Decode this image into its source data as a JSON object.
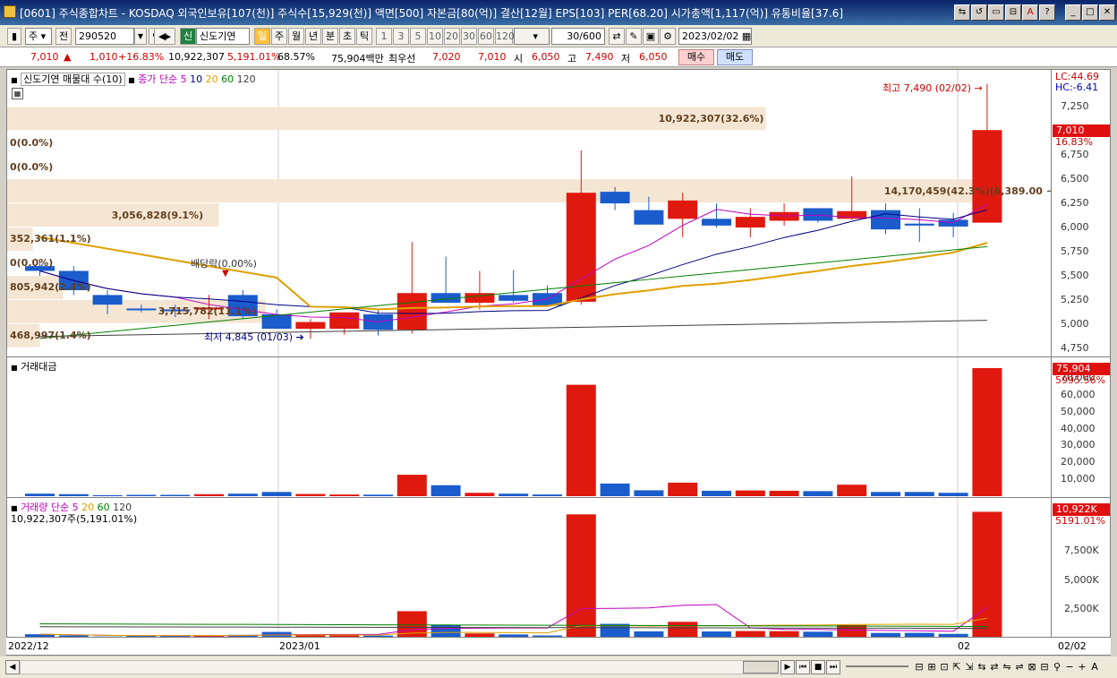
{
  "window": {
    "title": "[0601] 주식종합차트 - KOSDAQ 외국인보유[107(천)] 주식수[15,929(천)] 액면[500] 자본금[80(억)] 결산[12월] EPS[103] PER[68.20] 시가총액[1,117(억)] 유통비율[37.6]"
  },
  "toolbar": {
    "mode": "주",
    "all_label": "전",
    "code": "290520",
    "new_label": "신",
    "stock_name": "신도기연",
    "periods": [
      "일",
      "주",
      "월",
      "년",
      "분",
      "초",
      "틱"
    ],
    "active_period": "일",
    "intervals": [
      "1",
      "3",
      "5",
      "10",
      "20",
      "30",
      "60",
      "120"
    ],
    "count": "30",
    "count_max": "/600",
    "date": "2023/02/02"
  },
  "quote": {
    "price": "7,010",
    "arrow": "▲",
    "change": "1,010",
    "change_pct": "+16.83%",
    "volume": "10,922,307",
    "volume_pct": "5,191.01%",
    "ratio": "68.57%",
    "amount": "75,904백만",
    "best_label": "최우선",
    "best_ask": "7,020",
    "best_bid": "7,010",
    "open_label": "시",
    "open": "6,050",
    "high_label": "고",
    "high": "7,490",
    "low_label": "저",
    "low": "6,050",
    "buy_label": "매수",
    "sell_label": "매도"
  },
  "price_pane": {
    "title": "신도기연 매물대 수(10)",
    "ma_label": "종가 단순",
    "ma_periods": [
      "5",
      "10",
      "20",
      "60",
      "120"
    ],
    "ma_colors": [
      "#c000c0",
      "#000080",
      "#e0a000",
      "#008000",
      "#404040"
    ],
    "lc": "LC:44.69",
    "hc": "HC:-6.41",
    "last_price": "7,010",
    "last_pct": "16.83%",
    "high_note": "최고 7,490 (02/02)",
    "low_note": "최저 4,845 (01/03)",
    "dividend_note": "배당락(0.00%)",
    "volume_profile": [
      {
        "label": "10,922,307(32.6%)",
        "frac": 0.326,
        "price": 7125
      },
      {
        "label": "0(0.0%)",
        "frac": 0,
        "price": 6875
      },
      {
        "label": "0(0.0%)",
        "frac": 0,
        "price": 6625
      },
      {
        "label": "14,170,459(42.3%)",
        "frac": 0.423,
        "price": 6375
      },
      {
        "label": "3,056,828(9.1%)",
        "frac": 0.091,
        "price": 6125
      },
      {
        "label": "352,361(1.1%)",
        "frac": 0.011,
        "price": 5875
      },
      {
        "label": "0(0.0%)",
        "frac": 0,
        "price": 5625
      },
      {
        "label": "805,942(2.4%)",
        "frac": 0.024,
        "price": 5375
      },
      {
        "label": "3,715,782(11.1%)",
        "frac": 0.111,
        "price": 5125
      },
      {
        "label": "468,997(1.4%)",
        "frac": 0.014,
        "price": 4875
      }
    ],
    "profile_range_note": "(6,389.00 ~ 6,182.00)",
    "yticks": [
      "7,250",
      "7,000",
      "6,750",
      "6,500",
      "6,250",
      "6,000",
      "5,750",
      "5,500",
      "5,250",
      "5,000",
      "4,750"
    ]
  },
  "amount_pane": {
    "title": "거래대금",
    "last_value": "75,904",
    "last_pct": "5995.56%",
    "yticks": [
      "70,000",
      "60,000",
      "50,000",
      "40,000",
      "30,000",
      "20,000",
      "10,000"
    ]
  },
  "volume_pane": {
    "title": "거래량 단순",
    "ma_periods": [
      "5",
      "20",
      "60",
      "120"
    ],
    "ma_colors": [
      "#c000c0",
      "#e0a000",
      "#008000",
      "#404040"
    ],
    "info": "10,922,307주(5,191.01%)",
    "last_value": "10,922K",
    "last_pct": "5191.01%",
    "yticks": [
      "7,500K",
      "5,000K",
      "2,500K"
    ]
  },
  "xaxis": {
    "labels": [
      "2022/12",
      "2023/01",
      "02"
    ],
    "right_label": "02/02"
  },
  "chart_data": {
    "type": "candlestick",
    "dates": [
      "12/21",
      "12/22",
      "12/23",
      "12/26",
      "12/27",
      "12/28",
      "12/29",
      "01/02",
      "01/03",
      "01/04",
      "01/05",
      "01/06",
      "01/09",
      "01/10",
      "01/11",
      "01/12",
      "01/13",
      "01/16",
      "01/17",
      "01/18",
      "01/19",
      "01/20",
      "01/25",
      "01/26",
      "01/27",
      "01/30",
      "01/31",
      "02/01",
      "02/02"
    ],
    "ohlc": [
      [
        5600,
        5650,
        5500,
        5550
      ],
      [
        5550,
        5600,
        5300,
        5350
      ],
      [
        5300,
        5350,
        5100,
        5200
      ],
      [
        5160,
        5200,
        5120,
        5150
      ],
      [
        5150,
        5200,
        5070,
        5140
      ],
      [
        5150,
        5300,
        5050,
        5170
      ],
      [
        5300,
        5350,
        5050,
        5080
      ],
      [
        5100,
        5150,
        4950,
        4950
      ],
      [
        4950,
        5050,
        4845,
        5020
      ],
      [
        4950,
        5120,
        4890,
        5120
      ],
      [
        5100,
        5150,
        4880,
        4940
      ],
      [
        4940,
        5850,
        4900,
        5320
      ],
      [
        5320,
        5700,
        5280,
        5220
      ],
      [
        5220,
        5550,
        5150,
        5320
      ],
      [
        5300,
        5560,
        5220,
        5240
      ],
      [
        5320,
        5400,
        5180,
        5190
      ],
      [
        5230,
        6800,
        5200,
        6360
      ],
      [
        6370,
        6420,
        6180,
        6250
      ],
      [
        6180,
        6320,
        6050,
        6030
      ],
      [
        6090,
        6360,
        5900,
        6280
      ],
      [
        6090,
        6250,
        6000,
        6020
      ],
      [
        6000,
        6200,
        5900,
        6110
      ],
      [
        6070,
        6250,
        6020,
        6160
      ],
      [
        6200,
        6200,
        6050,
        6070
      ],
      [
        6090,
        6530,
        6080,
        6170
      ],
      [
        6180,
        6250,
        5930,
        5980
      ],
      [
        6040,
        6200,
        5850,
        6020
      ],
      [
        6080,
        6150,
        5900,
        6010
      ],
      [
        6050,
        7490,
        6050,
        7010
      ]
    ],
    "amount": [
      1500,
      1200,
      600,
      800,
      800,
      1200,
      1500,
      2500,
      1300,
      1000,
      900,
      12700,
      6500,
      2000,
      1500,
      1000,
      66000,
      7500,
      3500,
      8000,
      3200,
      3400,
      3200,
      3000,
      6800,
      2500,
      2500,
      2000,
      75904
    ],
    "volume": [
      300,
      200,
      100,
      150,
      150,
      200,
      250,
      500,
      280,
      200,
      180,
      2300,
      1100,
      370,
      280,
      190,
      10700,
      1200,
      550,
      1380,
      540,
      580,
      570,
      520,
      1100,
      410,
      420,
      330,
      10922
    ],
    "ylim_price": [
      4700,
      7560
    ],
    "ylim_amount": [
      0,
      78000
    ],
    "ylim_volume": [
      0,
      11500
    ]
  }
}
